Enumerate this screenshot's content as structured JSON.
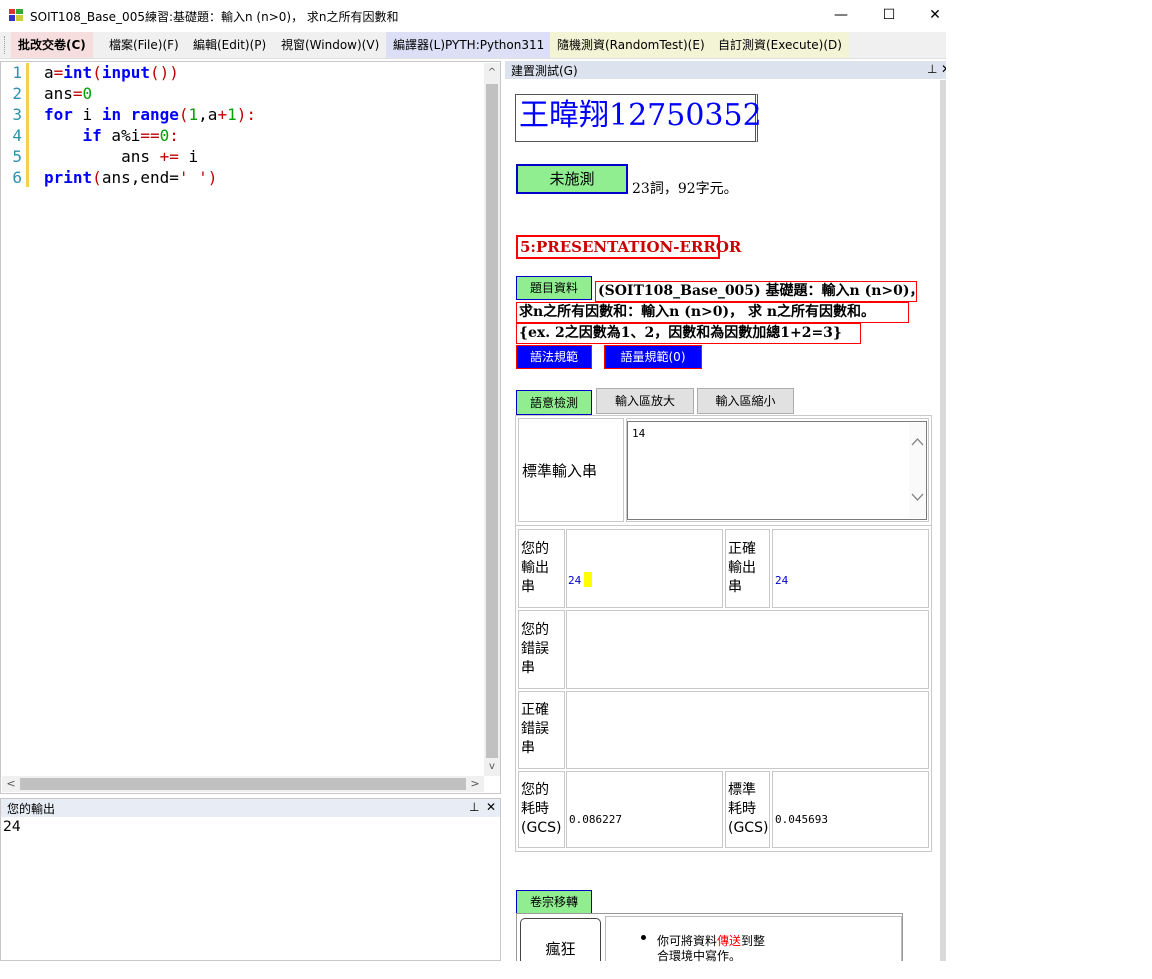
{
  "window": {
    "title": "SOIT108_Base_005練習:基礎題：輸入n (n>0)， 求n之所有因數和",
    "minimize_glyph": "—",
    "maximize_glyph": "☐",
    "close_glyph": "✕"
  },
  "menu": {
    "items": [
      {
        "label": "批改交卷(C)"
      },
      {
        "label": "檔案(File)(F)"
      },
      {
        "label": "編輯(Edit)(P)"
      },
      {
        "label": "視窗(Window)(V)"
      },
      {
        "label": "編譯器(L)PYTH:Python311"
      },
      {
        "label": "隨機測資(RandomTest)(E)"
      },
      {
        "label": "自訂測資(Execute)(D)"
      }
    ]
  },
  "editor": {
    "line_numbers": [
      "1",
      "2",
      "3",
      "4",
      "5",
      "6"
    ],
    "scroll_left_glyph": "<",
    "scroll_right_glyph": ">",
    "scroll_up_glyph": "^",
    "scroll_down_glyph": "v"
  },
  "output_panel": {
    "title": "您的輸出",
    "pin_glyph": "⊥",
    "close_glyph": "✕",
    "content": "24"
  },
  "test_panel": {
    "title": "建置測試(G)",
    "pin_glyph": "⊥",
    "close_glyph": "✕",
    "student_name": "王暐翔12750352",
    "status_button": "未施測",
    "stats": "23詞，92字元。",
    "result": "5:PRESENTATION-ERROR",
    "problem_button": "題目資料",
    "problem_line1": "(SOIT108_Base_005) 基礎題：輸入n (n>0)，",
    "problem_line2": "求n之所有因數和：輸入n (n>0)， 求 n之所有因數和。",
    "problem_line3": "{ex. 2之因數為1、2，因數和為因數加總1+2=3}",
    "syntax_button": "語法規範",
    "quantity_button": "語量規範(0)",
    "semantic_button": "語意檢測",
    "zoom_in_button": "輸入區放大",
    "zoom_out_button": "輸入區縮小",
    "std_input_label": "標準輸入串",
    "std_input_value": "14",
    "your_output_label": "您的輸出串",
    "your_output_value": "24",
    "correct_output_label": "正確輸出串",
    "correct_output_value": "24",
    "your_error_label": "您的錯誤串",
    "correct_error_label": "正確錯誤串",
    "your_time_label": "您的耗時(GCS)",
    "your_time_value": "0.086227",
    "std_time_label": "標準耗時(GCS)",
    "std_time_value": "0.045693",
    "archive_button": "卷宗移轉",
    "crazy_button": "瘋狂",
    "hint_pre": "你可將資料",
    "hint_highlight": "傳送",
    "hint_post": "到整",
    "hint_line2": "合環境中寫作。"
  },
  "colors": {
    "editor_keyword": "#0000ff",
    "editor_number": "#00a000",
    "editor_string": "#c00000",
    "result_border": "#ff0000",
    "status_button_bg": "#90ee90",
    "button_blue": "#0000ff",
    "caret_marker": "#ffff00"
  }
}
